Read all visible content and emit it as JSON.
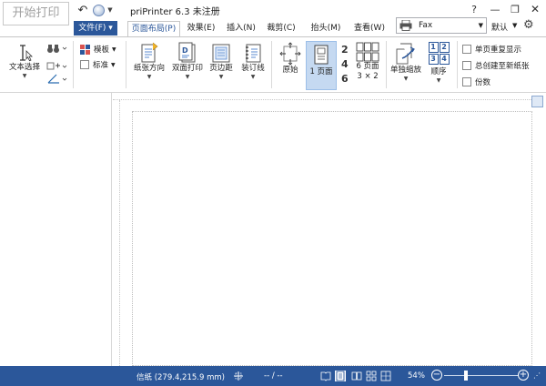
{
  "title_bar": {
    "print_button": "开始打印",
    "app_title": "priPrinter 6.3 未注册",
    "help": "?",
    "minimize": "—",
    "maximize": "❐",
    "close": "✕"
  },
  "tabs": {
    "file": "文件(F) ▾",
    "items": [
      "页面布局(P)",
      "效果(E)",
      "插入(N)",
      "裁剪(C)",
      "抬头(M)",
      "查看(W)"
    ],
    "active_index": 0
  },
  "printer": {
    "name": "Fax",
    "default_label": "默认"
  },
  "ribbon": {
    "text_select": "文本选择",
    "template": "模板",
    "standard": "标准",
    "orientation": "纸张方向",
    "duplex": "双面打印",
    "margins": "页边距",
    "binding": "装订线",
    "original": "原始",
    "one_page": "1 页面",
    "numbers": [
      "2",
      "4",
      "6"
    ],
    "six_page": "6 页面",
    "grid": "3 × 2",
    "single_scale": "单独缩放",
    "order": "顺序",
    "order_digits": [
      "1",
      "2",
      "3",
      "4"
    ],
    "checkboxes": [
      "单页重复显示",
      "总创建至新纸张",
      "份数"
    ]
  },
  "status": {
    "paper": "信纸 (279.4,215.9 mm)",
    "page_nav": "-- / --",
    "zoom": "54%"
  },
  "zoom_level": 0.54,
  "colors": {
    "accent": "#2b579a",
    "ribbon_active": "#c5d9f1"
  }
}
